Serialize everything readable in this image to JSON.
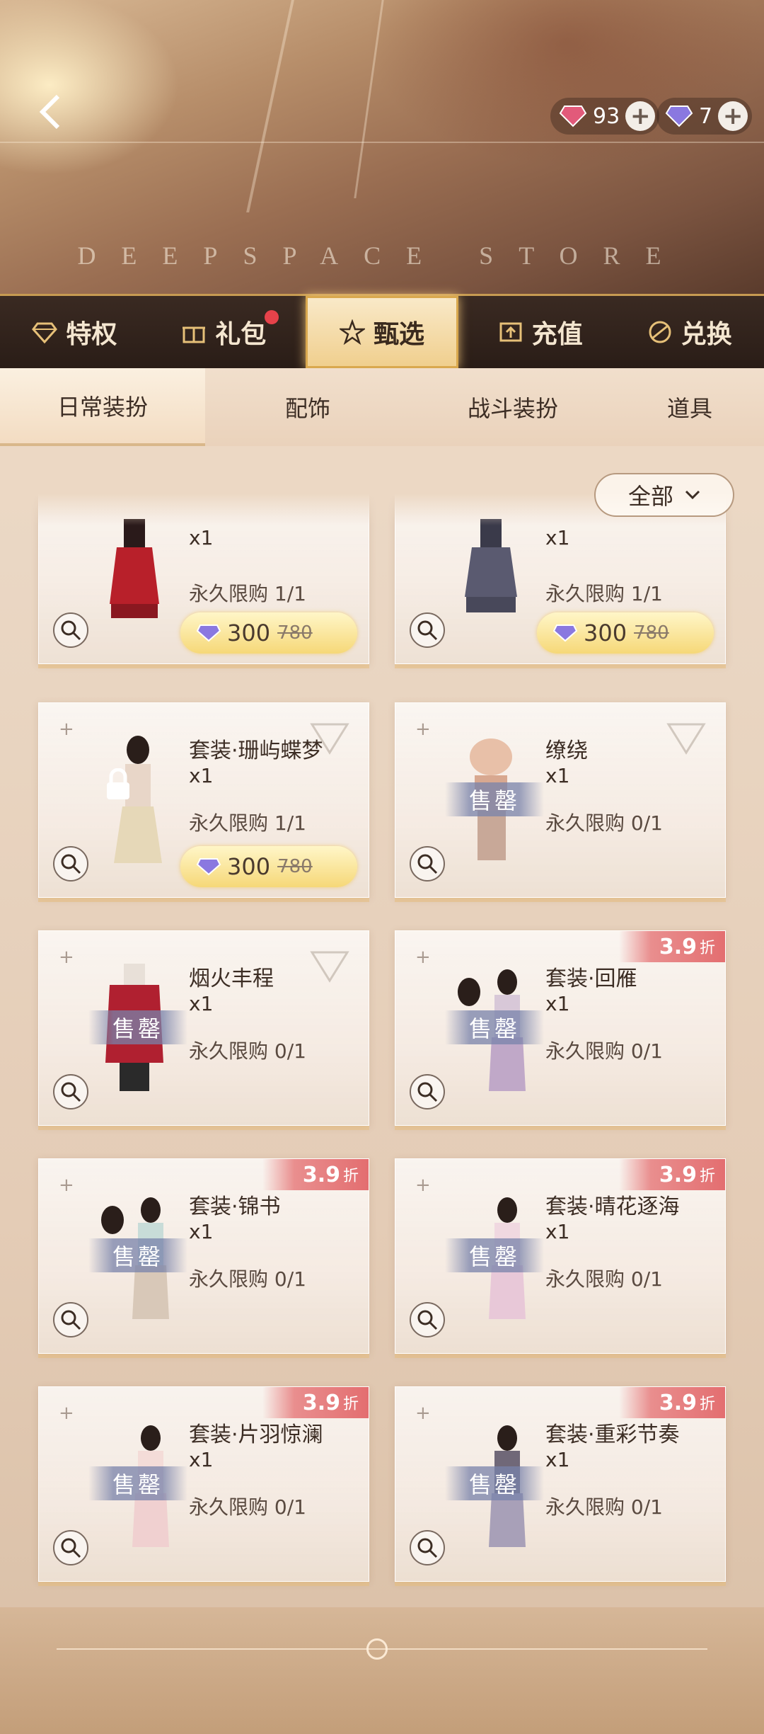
{
  "store_name": "DEEPSPACE STORE",
  "currency": [
    {
      "name": "red-gem",
      "amount": "93"
    },
    {
      "name": "purple-gem",
      "amount": "7"
    }
  ],
  "main_tabs": [
    {
      "label": "特权",
      "icon": "diamond-icon"
    },
    {
      "label": "礼包",
      "icon": "gift-icon"
    },
    {
      "label": "甄选",
      "icon": "star-icon"
    },
    {
      "label": "充值",
      "icon": "recharge-icon"
    },
    {
      "label": "兑换",
      "icon": "exchange-icon"
    }
  ],
  "sub_tabs": [
    "日常装扮",
    "配饰",
    "战斗装扮",
    "道具"
  ],
  "filter": {
    "label": "全部"
  },
  "cards": [
    {
      "name": "",
      "qty": "x1",
      "limit": "永久限购 1/1",
      "price": "300",
      "orig": "780"
    },
    {
      "name": "",
      "qty": "x1",
      "limit": "永久限购 1/1",
      "price": "300",
      "orig": "780"
    },
    {
      "name": "套装·珊屿蝶梦",
      "qty": "x1",
      "limit": "永久限购 1/1",
      "price": "300",
      "orig": "780"
    },
    {
      "name": "缭绕",
      "qty": "x1",
      "limit": "永久限购 0/1",
      "sold": "售罄"
    },
    {
      "name": "烟火丰程",
      "qty": "x1",
      "limit": "永久限购 0/1",
      "sold": "售罄"
    },
    {
      "name": "套装·回雁",
      "qty": "x1",
      "limit": "永久限购 0/1",
      "sold": "售罄",
      "discount": "3.9",
      "discount_unit": "折"
    },
    {
      "name": "套装·锦书",
      "qty": "x1",
      "limit": "永久限购 0/1",
      "sold": "售罄",
      "discount": "3.9",
      "discount_unit": "折"
    },
    {
      "name": "套装·晴花逐海",
      "qty": "x1",
      "limit": "永久限购 0/1",
      "sold": "售罄",
      "discount": "3.9",
      "discount_unit": "折"
    },
    {
      "name": "套装·片羽惊澜",
      "qty": "x1",
      "limit": "永久限购 0/1",
      "sold": "售罄",
      "discount": "3.9",
      "discount_unit": "折"
    },
    {
      "name": "套装·重彩节奏",
      "qty": "x1",
      "limit": "永久限购 0/1",
      "sold": "售罄",
      "discount": "3.9",
      "discount_unit": "折"
    }
  ]
}
